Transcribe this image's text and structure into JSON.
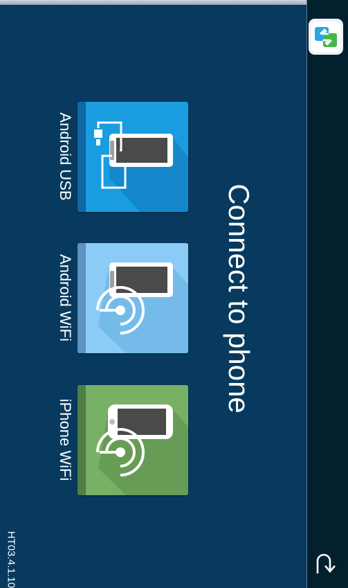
{
  "screen": {
    "title": "Connect to phone",
    "version": "HT03.4.1.10"
  },
  "options": [
    {
      "label": "Android USB",
      "icon": "usb-phone-icon",
      "color": "#1a9de0"
    },
    {
      "label": "Android WiFi",
      "icon": "wifi-phone-icon",
      "color": "#8ccbf6"
    },
    {
      "label": "iPhone WiFi",
      "icon": "wifi-iphone-icon",
      "color": "#78b066"
    }
  ],
  "sidebar": {
    "app_icon": "mirror-app-icon",
    "back_icon": "back-arrow-icon"
  }
}
